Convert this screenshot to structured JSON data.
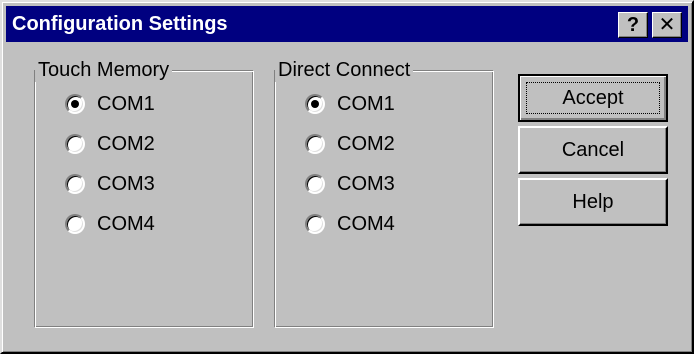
{
  "window": {
    "title": "Configuration Settings",
    "help_glyph": "?",
    "close_glyph": "✕"
  },
  "touch_memory": {
    "label": "Touch Memory",
    "options": [
      {
        "label": "COM1",
        "checked": true
      },
      {
        "label": "COM2",
        "checked": false
      },
      {
        "label": "COM3",
        "checked": false
      },
      {
        "label": "COM4",
        "checked": false
      }
    ]
  },
  "direct_connect": {
    "label": "Direct Connect",
    "options": [
      {
        "label": "COM1",
        "checked": true
      },
      {
        "label": "COM2",
        "checked": false
      },
      {
        "label": "COM3",
        "checked": false
      },
      {
        "label": "COM4",
        "checked": false
      }
    ]
  },
  "buttons": {
    "accept": "Accept",
    "cancel": "Cancel",
    "help": "Help"
  },
  "colors": {
    "titlebar": "#000080",
    "face": "#c0c0c0"
  }
}
